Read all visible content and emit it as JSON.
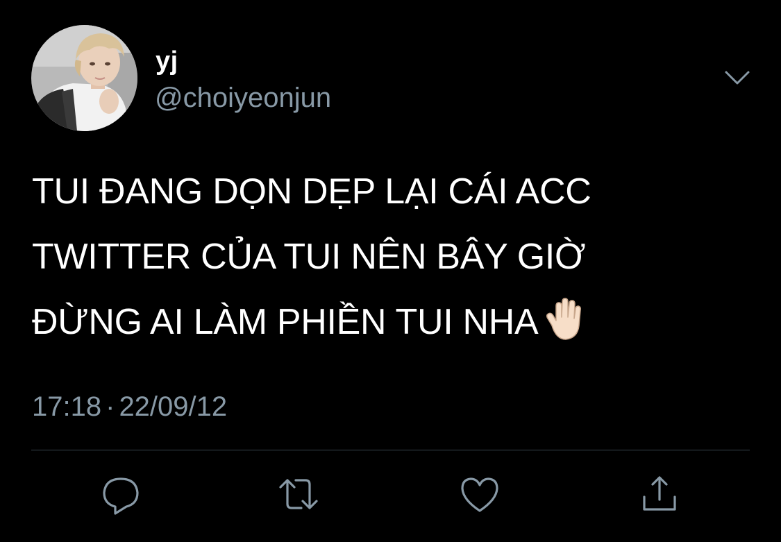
{
  "user": {
    "display_name": "yj",
    "handle": "@choiyeonjun"
  },
  "tweet": {
    "lines": [
      "TUI ĐANG DỌN DẸP LẠI CÁI ACC",
      "TWITTER CỦA TUI NÊN BÂY GIỜ",
      "ĐỪNG AI LÀM PHIỀN TUI NHA"
    ],
    "emoji": "raised-hand"
  },
  "meta": {
    "time": "17:18",
    "separator": "·",
    "date": "22/09/12"
  },
  "icons": {
    "more": "chevron-down-icon",
    "reply": "reply-icon",
    "retweet": "retweet-icon",
    "like": "heart-icon",
    "share": "share-icon"
  },
  "colors": {
    "background": "#000000",
    "text": "#ffffff",
    "secondary_text": "#8899a6",
    "divider": "#38444d",
    "icon": "#8899a6"
  }
}
